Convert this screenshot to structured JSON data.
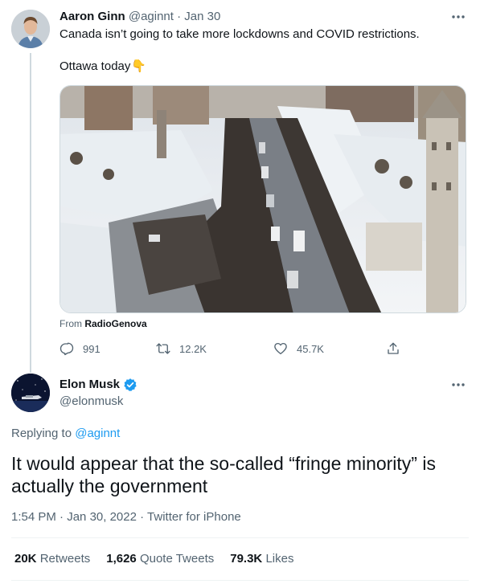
{
  "tweet1": {
    "author_name": "Aaron Ginn",
    "author_handle": "@aginnt",
    "separator": "·",
    "date": "Jan 30",
    "text_line1": "Canada isn’t going to take more lockdowns and COVID restrictions.",
    "text_line2": "Ottawa today",
    "emoji": "👇",
    "media_source_prefix": "From",
    "media_source_name": "RadioGenova",
    "replies": "991",
    "retweets": "12.2K",
    "likes": "45.7K"
  },
  "tweet2": {
    "author_name": "Elon Musk",
    "author_handle": "@elonmusk",
    "replying_prefix": "Replying to",
    "replying_to": "@aginnt",
    "text": "It would appear that the so-called “fringe minority” is actually the government",
    "time": "1:54 PM",
    "separator": "·",
    "date": "Jan 30, 2022",
    "client": "Twitter for iPhone",
    "stats": {
      "retweets_value": "20K",
      "retweets_label": "Retweets",
      "quotes_value": "1,626",
      "quotes_label": "Quote Tweets",
      "likes_value": "79.3K",
      "likes_label": "Likes"
    }
  },
  "icons": {
    "reply": "reply-icon",
    "retweet": "retweet-icon",
    "like": "heart-icon",
    "share": "share-icon",
    "verified": "verified-badge-icon",
    "more": "more-icon"
  },
  "colors": {
    "accent": "#1d9bf0",
    "text": "#0f1419",
    "muted": "#536471",
    "border": "#cfd9de"
  }
}
